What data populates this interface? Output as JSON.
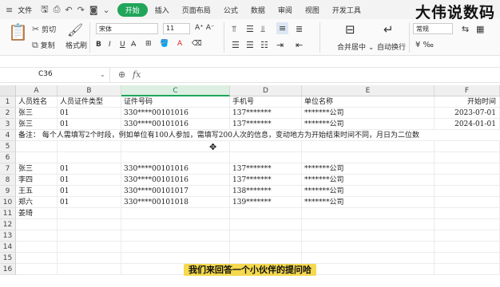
{
  "menubar": {
    "file": "文件",
    "tabs": [
      "开始",
      "插入",
      "页面布局",
      "公式",
      "数据",
      "审阅",
      "视图",
      "开发工具"
    ],
    "active_index": 0,
    "watermark": "大伟说数码"
  },
  "ribbon": {
    "cut": "剪切",
    "copy": "复制",
    "painter": "格式刷",
    "font": "宋体",
    "size": "11",
    "merge": "合并居中",
    "wrap": "自动换行",
    "number_format": "常规"
  },
  "formula_bar": {
    "cell_ref": "C36",
    "fx": "fx",
    "value": ""
  },
  "columns": [
    "A",
    "B",
    "C",
    "D",
    "E",
    "F"
  ],
  "selected_column": "C",
  "rows": [
    {
      "n": "1",
      "cells": [
        "人员姓名",
        "人员证件类型",
        "证件号码",
        "手机号",
        "单位名称",
        "开始时间"
      ]
    },
    {
      "n": "2",
      "cells": [
        "张三",
        "01",
        "330****00101016",
        "137*******",
        "*******公司",
        "2023-07-01"
      ]
    },
    {
      "n": "3",
      "cells": [
        "张三",
        "01",
        "330****00101016",
        "137*******",
        "*******公司",
        "2024-01-01"
      ]
    },
    {
      "n": "4",
      "note": "备注：    每个人需填写2个时段，例如单位有100人参加，需填写200人次的信息，变动地方为开始结束时间不同，月日为二位数"
    },
    {
      "n": "5",
      "cells": [
        "",
        "",
        "",
        "",
        "",
        ""
      ]
    },
    {
      "n": "6",
      "cells": [
        "",
        "",
        "",
        "",
        "",
        ""
      ]
    },
    {
      "n": "7",
      "cells": [
        "张三",
        "01",
        "330****00101016",
        "137*******",
        "*******公司",
        ""
      ]
    },
    {
      "n": "8",
      "cells": [
        "李四",
        "01",
        "330****00101016",
        "137*******",
        "*******公司",
        ""
      ]
    },
    {
      "n": "9",
      "cells": [
        "王五",
        "01",
        "330****00101017",
        "138*******",
        "*******公司",
        ""
      ]
    },
    {
      "n": "10",
      "cells": [
        "郑六",
        "01",
        "330****00101018",
        "139*******",
        "*******公司",
        ""
      ]
    },
    {
      "n": "11",
      "cells": [
        "姜琦",
        "",
        "",
        "",
        "",
        ""
      ]
    },
    {
      "n": "12",
      "cells": [
        "",
        "",
        "",
        "",
        "",
        ""
      ]
    },
    {
      "n": "13",
      "cells": [
        "",
        "",
        "",
        "",
        "",
        ""
      ]
    },
    {
      "n": "14",
      "cells": [
        "",
        "",
        "",
        "",
        "",
        ""
      ]
    },
    {
      "n": "15",
      "cells": [
        "",
        "",
        "",
        "",
        "",
        ""
      ]
    },
    {
      "n": "16",
      "cells": [
        "",
        "",
        "",
        "",
        "",
        ""
      ]
    }
  ],
  "subtitle": "我们来回答一个小伙伴的提问哈"
}
